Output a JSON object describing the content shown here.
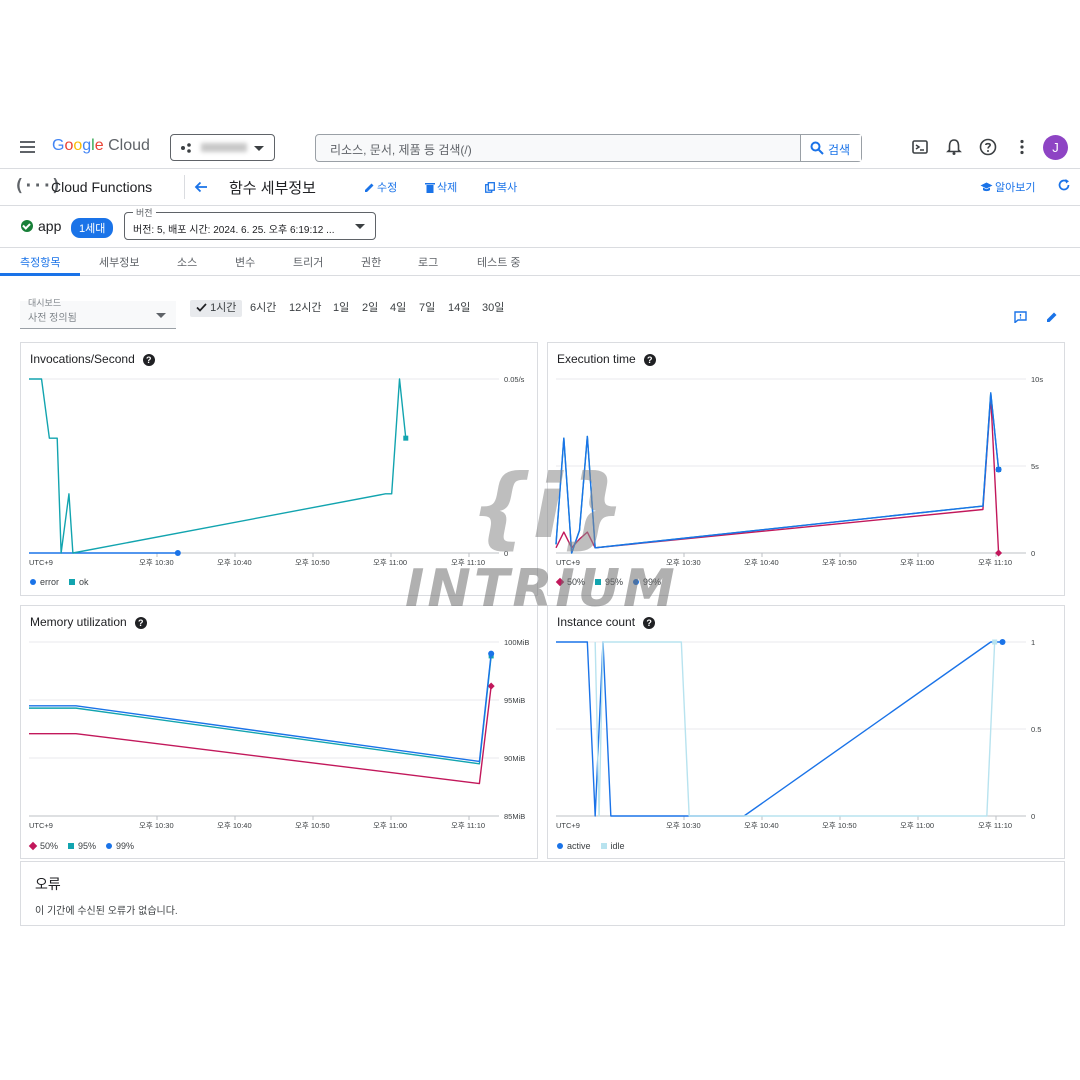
{
  "topbar": {
    "logo_google": "Google",
    "logo_cloud": "Cloud",
    "search_placeholder": "리소스, 문서, 제품 등 검색(/)",
    "search_button": "검색",
    "avatar_initial": "J"
  },
  "secbar": {
    "product_name": "Cloud Functions",
    "page_title": "함수 세부정보",
    "edit": "수정",
    "delete": "삭제",
    "copy": "복사",
    "learn": "알아보기"
  },
  "function": {
    "name": "app",
    "generation": "1세대",
    "version_label": "버전",
    "version_value": "버전: 5, 배포 시간: 2024. 6. 25. 오후 6:19:12 ..."
  },
  "tabs": [
    "측정항목",
    "세부정보",
    "소스",
    "변수",
    "트리거",
    "권한",
    "로그",
    "테스트 중"
  ],
  "dashboard": {
    "label": "대시보드",
    "value": "사전 정의됨",
    "ranges": [
      "1시간",
      "6시간",
      "12시간",
      "1일",
      "2일",
      "4일",
      "7일",
      "14일",
      "30일"
    ],
    "selected_range": "1시간"
  },
  "chart_data": [
    {
      "type": "line",
      "title": "Invocations/Second",
      "x_ticks": [
        "UTC+9",
        "오후 10:30",
        "오후 10:40",
        "오후 10:50",
        "오후 11:00",
        "오후 11:10"
      ],
      "y_ticks": [
        "0",
        "0.05/s"
      ],
      "ylim": [
        0,
        0.05
      ],
      "series": [
        {
          "name": "error",
          "color": "#1a73e8",
          "values": [
            [
              0,
              0
            ],
            [
              19,
              0
            ]
          ]
        },
        {
          "name": "ok",
          "color": "#12a4af",
          "values": [
            [
              0,
              0.05
            ],
            [
              1.6,
              0.05
            ],
            [
              2.6,
              0.033
            ],
            [
              3.6,
              0.033
            ],
            [
              4.1,
              0
            ],
            [
              5.1,
              0.017
            ],
            [
              5.6,
              0
            ],
            [
              45.5,
              0.017
            ],
            [
              46.3,
              0.017
            ],
            [
              47.3,
              0.05
            ],
            [
              48.1,
              0.033
            ]
          ]
        }
      ]
    },
    {
      "type": "line",
      "title": "Execution time",
      "x_ticks": [
        "UTC+9",
        "오후 10:30",
        "오후 10:40",
        "오후 10:50",
        "오후 11:00",
        "오후 11:10"
      ],
      "y_ticks": [
        "0",
        "5s",
        "10s"
      ],
      "ylim": [
        0,
        10
      ],
      "series": [
        {
          "name": "50%",
          "color": "#c2185b",
          "values": [
            [
              0,
              0.3
            ],
            [
              1,
              1.2
            ],
            [
              2,
              0.3
            ],
            [
              3,
              0.8
            ],
            [
              4,
              1.2
            ],
            [
              5,
              0.3
            ],
            [
              54.5,
              2.5
            ],
            [
              55.5,
              9
            ],
            [
              56.5,
              0
            ]
          ]
        },
        {
          "name": "95%",
          "color": "#12a4af",
          "values": [
            [
              0,
              0.5
            ],
            [
              1,
              6.6
            ],
            [
              2,
              0
            ],
            [
              3,
              1.3
            ],
            [
              4,
              6.7
            ],
            [
              5,
              0.3
            ],
            [
              54.5,
              2.7
            ],
            [
              55.5,
              9.2
            ],
            [
              56.5,
              4.8
            ]
          ]
        },
        {
          "name": "99%",
          "color": "#1a73e8",
          "values": [
            [
              0,
              0.5
            ],
            [
              1,
              6.6
            ],
            [
              2,
              0
            ],
            [
              3,
              1.3
            ],
            [
              4,
              6.7
            ],
            [
              5,
              0.3
            ],
            [
              54.5,
              2.7
            ],
            [
              55.5,
              9.2
            ],
            [
              56.5,
              4.8
            ]
          ]
        }
      ]
    },
    {
      "type": "line",
      "title": "Memory utilization",
      "x_ticks": [
        "UTC+9",
        "오후 10:30",
        "오후 10:40",
        "오후 10:50",
        "오후 11:00",
        "오후 11:10"
      ],
      "y_ticks": [
        "85MiB",
        "90MiB",
        "95MiB",
        "100MiB"
      ],
      "ylim": [
        85,
        100
      ],
      "series": [
        {
          "name": "50%",
          "color": "#c2185b",
          "values": [
            [
              0,
              92.1
            ],
            [
              6,
              92.1
            ],
            [
              57.5,
              87.8
            ],
            [
              59,
              96.2
            ]
          ]
        },
        {
          "name": "95%",
          "color": "#12a4af",
          "values": [
            [
              0,
              94.3
            ],
            [
              6,
              94.3
            ],
            [
              57.5,
              89.5
            ],
            [
              59,
              98.8
            ]
          ]
        },
        {
          "name": "99%",
          "color": "#1a73e8",
          "values": [
            [
              0,
              94.5
            ],
            [
              6,
              94.5
            ],
            [
              57.5,
              89.7
            ],
            [
              59,
              99
            ]
          ]
        }
      ]
    },
    {
      "type": "line",
      "title": "Instance count",
      "x_ticks": [
        "UTC+9",
        "오후 10:30",
        "오후 10:40",
        "오후 10:50",
        "오후 11:00",
        "오후 11:10"
      ],
      "y_ticks": [
        "0",
        "0.5",
        "1"
      ],
      "ylim": [
        0,
        1
      ],
      "series": [
        {
          "name": "active",
          "color": "#1a73e8",
          "values": [
            [
              0,
              1
            ],
            [
              4,
              1
            ],
            [
              5,
              0
            ],
            [
              6,
              1
            ],
            [
              7,
              0
            ],
            [
              24,
              0
            ],
            [
              55.5,
              1
            ],
            [
              57,
              1
            ]
          ]
        },
        {
          "name": "idle",
          "color": "#b8e3ef",
          "values": [
            [
              5,
              1
            ],
            [
              5.5,
              0
            ],
            [
              6,
              1
            ],
            [
              16,
              1
            ],
            [
              17,
              0
            ],
            [
              55,
              0
            ],
            [
              56,
              1
            ]
          ]
        }
      ]
    }
  ],
  "errors": {
    "title": "오류",
    "message": "이 기간에 수신된 오류가 없습니다."
  },
  "watermark": {
    "word": "INTRIUM",
    "brace": "{i}"
  },
  "colors": {
    "accent": "#1a73e8",
    "ok_status": "#188038",
    "pink": "#c2185b",
    "teal": "#12a4af"
  }
}
